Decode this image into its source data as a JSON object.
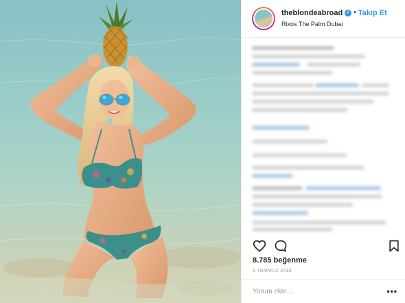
{
  "post": {
    "username": "theblondeabroad",
    "verified_icon": "verified-badge-icon",
    "separator": "•",
    "follow_label": "Takip Et",
    "location": "Rixos The Palm Dubai",
    "likes_text": "8.785 beğenme",
    "date_text": "5 TEMMUZ 2016",
    "comment_placeholder": "Yorum ekle...",
    "more_label": "•••"
  },
  "icons": {
    "like": "heart-outline-icon",
    "comment": "speech-bubble-icon",
    "save": "bookmark-icon",
    "options": "more-options-icon"
  },
  "colors": {
    "link_blue": "#3897f0",
    "text": "#262626",
    "muted": "#999999",
    "divider": "#efefef"
  }
}
